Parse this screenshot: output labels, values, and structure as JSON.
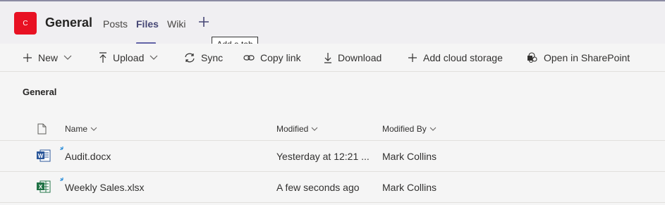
{
  "team": {
    "avatar_letter": "C",
    "name": "General",
    "avatar_color": "#e81123"
  },
  "tabs": [
    {
      "label": "Posts",
      "active": false
    },
    {
      "label": "Files",
      "active": true
    },
    {
      "label": "Wiki",
      "active": false
    }
  ],
  "add_tab": {
    "icon": "plus-icon",
    "tooltip": "Add a tab"
  },
  "toolbar": {
    "new": "New",
    "upload": "Upload",
    "sync": "Sync",
    "copy_link": "Copy link",
    "download": "Download",
    "add_cloud_storage": "Add cloud storage",
    "open_in_sharepoint": "Open in SharePoint"
  },
  "section_title": "General",
  "columns": {
    "name": "Name",
    "modified": "Modified",
    "modified_by": "Modified By"
  },
  "files": [
    {
      "name": "Audit.docx",
      "type": "word",
      "modified": "Yesterday at 12:21 ...",
      "modified_by": "Mark Collins"
    },
    {
      "name": "Weekly Sales.xlsx",
      "type": "excel",
      "modified": "A few seconds ago",
      "modified_by": "Mark Collins"
    }
  ],
  "colors": {
    "accent": "#6264a7",
    "word": "#2b579a",
    "excel": "#217346"
  }
}
